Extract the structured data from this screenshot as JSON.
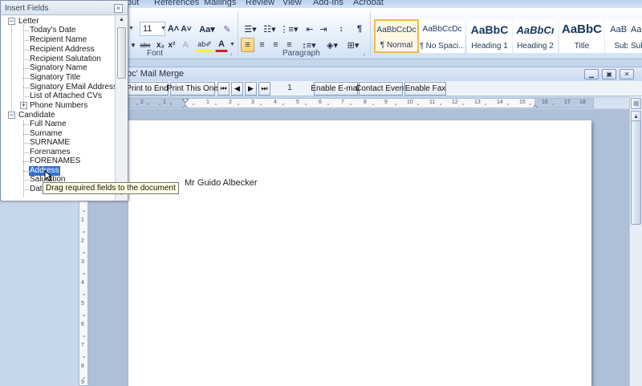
{
  "ribbon": {
    "tabs": [
      "out",
      "References",
      "Mailings",
      "Review",
      "View",
      "Add-Ins",
      "Acrobat"
    ],
    "font_size": "11",
    "groups": {
      "font": "Font",
      "paragraph": "Paragraph"
    },
    "glyphs": {
      "grow_font": "A˄",
      "shrink_font": "A˅",
      "change_case": "Aa▾",
      "strikethrough": "abc",
      "subscript": "x₂",
      "superscript": "x²",
      "highlight": "ab✐",
      "font_color": "A"
    },
    "styles": [
      {
        "sample": "AaBbCcDc",
        "name": "¶ Normal",
        "selected": true
      },
      {
        "sample": "AaBbCcDc",
        "name": "¶ No Spaci...",
        "selected": false
      },
      {
        "sample": "AaBbC",
        "name": "Heading 1",
        "selected": false
      },
      {
        "sample": "AaBbCı",
        "name": "Heading 2",
        "selected": false
      },
      {
        "sample": "AaBbC",
        "name": "Title",
        "selected": false
      },
      {
        "sample": "AaBbCcI",
        "name": "Subtitle",
        "selected": false
      },
      {
        "sample": "AaBb",
        "name": "Subt",
        "selected": false
      }
    ]
  },
  "mail_merge": {
    "title": "oc' Mail Merge",
    "toolbar": {
      "print_to_end": "Print to End",
      "print_this_one": "Print This One",
      "record_number": "1",
      "enable_email": "Enable E-mail",
      "contact_event": "Contact Event",
      "enable_fax": "Enable Fax"
    }
  },
  "document": {
    "text": "Mr Guido Albecker"
  },
  "ruler": {
    "h_numbers": [
      "2",
      "1",
      "1",
      "2",
      "3",
      "4",
      "5",
      "6",
      "7",
      "8",
      "9",
      "10",
      "11",
      "12",
      "13",
      "14",
      "15",
      "16",
      "17",
      "18"
    ],
    "v_numbers": [
      "1",
      "2",
      "3",
      "4",
      "5",
      "6",
      "7",
      "8",
      "9"
    ]
  },
  "insert_fields": {
    "title": "Insert Fields",
    "close_glyph": "×",
    "letter": {
      "label": "Letter",
      "items": [
        "Today's Date",
        "Recipient Name",
        "Recipient Address",
        "Recipient Salutation",
        "Signatory Name",
        "Signatory Title",
        "Signatory EMail Address",
        "List of Attached CVs",
        "Phone Numbers"
      ]
    },
    "candidate": {
      "label": "Candidate",
      "items": [
        "Full Name",
        "Surname",
        "SURNAME",
        "Forenames",
        "FORENAMES",
        "Address",
        "Salutation",
        "Date"
      ]
    }
  },
  "tooltip": "Drag required fields to the document"
}
